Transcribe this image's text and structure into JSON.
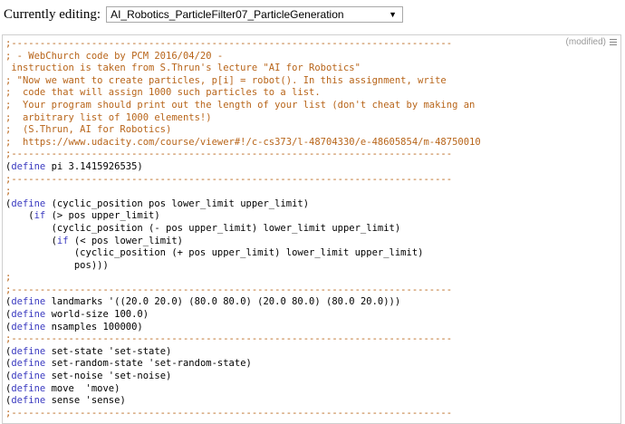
{
  "header": {
    "label": "Currently editing:",
    "selected_file": "AI_Robotics_ParticleFilter07_ParticleGeneration"
  },
  "editor": {
    "status": "(modified)",
    "lines": [
      [
        {
          "t": ";-----------------------------------------------------------------------------",
          "c": "sep"
        }
      ],
      [
        {
          "t": "; - WebChurch code by PCM 2016/04/20 -",
          "c": "c"
        }
      ],
      [
        {
          "t": " instruction is taken from S.Thrun's lecture \"AI for Robotics\"",
          "c": "c"
        }
      ],
      [
        {
          "t": "; \"Now we want to create particles, p[i] = robot(). In this assignment, write",
          "c": "c"
        }
      ],
      [
        {
          "t": ";  code that will assign 1000 such particles to a list.",
          "c": "c"
        }
      ],
      [
        {
          "t": ";  Your program should print out the length of your list (don't cheat by making an",
          "c": "c"
        }
      ],
      [
        {
          "t": ";  arbitrary list of 1000 elements!)",
          "c": "c"
        }
      ],
      [
        {
          "t": ";  (S.Thrun, AI for Robotics)",
          "c": "c"
        }
      ],
      [
        {
          "t": ";  https://www.udacity.com/course/viewer#!/c-cs373/l-48704330/e-48605854/m-48750010",
          "c": "c"
        }
      ],
      [
        {
          "t": ";-----------------------------------------------------------------------------",
          "c": "sep"
        }
      ],
      [
        {
          "t": "(",
          "c": ""
        },
        {
          "t": "define",
          "c": "k"
        },
        {
          "t": " pi 3.1415926535)",
          "c": ""
        }
      ],
      [
        {
          "t": ";-----------------------------------------------------------------------------",
          "c": "sep"
        }
      ],
      [
        {
          "t": ";",
          "c": "c"
        }
      ],
      [
        {
          "t": "(",
          "c": ""
        },
        {
          "t": "define",
          "c": "k"
        },
        {
          "t": " (cyclic_position pos lower_limit upper_limit)",
          "c": ""
        }
      ],
      [
        {
          "t": "    (",
          "c": ""
        },
        {
          "t": "if",
          "c": "k"
        },
        {
          "t": " (> pos upper_limit)",
          "c": ""
        }
      ],
      [
        {
          "t": "        (cyclic_position (- pos upper_limit) lower_limit upper_limit)",
          "c": ""
        }
      ],
      [
        {
          "t": "        (",
          "c": ""
        },
        {
          "t": "if",
          "c": "k"
        },
        {
          "t": " (< pos lower_limit)",
          "c": ""
        }
      ],
      [
        {
          "t": "            (cyclic_position (+ pos upper_limit) lower_limit upper_limit)",
          "c": ""
        }
      ],
      [
        {
          "t": "            pos)))",
          "c": ""
        }
      ],
      [
        {
          "t": ";",
          "c": "c"
        }
      ],
      [
        {
          "t": ";-----------------------------------------------------------------------------",
          "c": "sep"
        }
      ],
      [
        {
          "t": "(",
          "c": ""
        },
        {
          "t": "define",
          "c": "k"
        },
        {
          "t": " landmarks '((20.0 20.0) (80.0 80.0) (20.0 80.0) (80.0 20.0)))",
          "c": ""
        }
      ],
      [
        {
          "t": "(",
          "c": ""
        },
        {
          "t": "define",
          "c": "k"
        },
        {
          "t": " world-size 100.0)",
          "c": ""
        }
      ],
      [
        {
          "t": "(",
          "c": ""
        },
        {
          "t": "define",
          "c": "k"
        },
        {
          "t": " nsamples 100000)",
          "c": ""
        }
      ],
      [
        {
          "t": ";-----------------------------------------------------------------------------",
          "c": "sep"
        }
      ],
      [
        {
          "t": "(",
          "c": ""
        },
        {
          "t": "define",
          "c": "k"
        },
        {
          "t": " set-state 'set-state)",
          "c": ""
        }
      ],
      [
        {
          "t": "(",
          "c": ""
        },
        {
          "t": "define",
          "c": "k"
        },
        {
          "t": " set-random-state 'set-random-state)",
          "c": ""
        }
      ],
      [
        {
          "t": "(",
          "c": ""
        },
        {
          "t": "define",
          "c": "k"
        },
        {
          "t": " set-noise 'set-noise)",
          "c": ""
        }
      ],
      [
        {
          "t": "(",
          "c": ""
        },
        {
          "t": "define",
          "c": "k"
        },
        {
          "t": " move  'move)",
          "c": ""
        }
      ],
      [
        {
          "t": "(",
          "c": ""
        },
        {
          "t": "define",
          "c": "k"
        },
        {
          "t": " sense 'sense)",
          "c": ""
        }
      ],
      [
        {
          "t": ";-----------------------------------------------------------------------------",
          "c": "sep"
        }
      ]
    ]
  }
}
